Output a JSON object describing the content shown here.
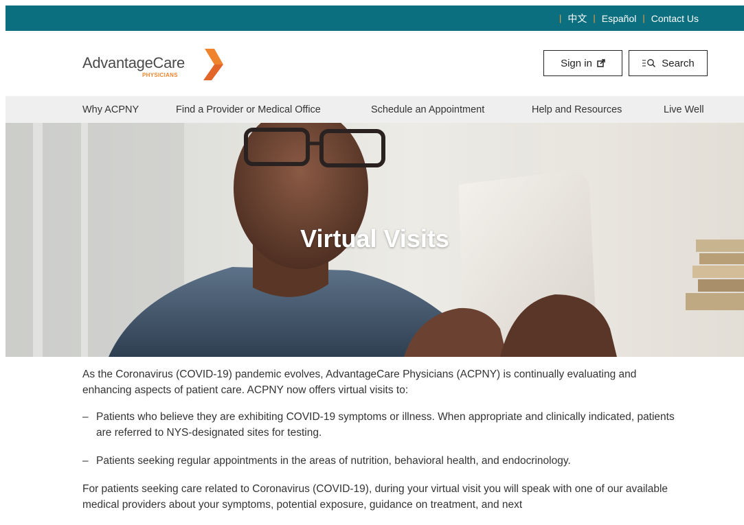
{
  "utility_nav": {
    "chinese": "中文",
    "spanish": "Español",
    "contact": "Contact Us"
  },
  "brand": {
    "name": "AdvantageCare",
    "sub": "PHYSICIANS"
  },
  "header": {
    "signin_label": "Sign in",
    "search_label": "Search"
  },
  "main_nav": [
    "Why ACPNY",
    "Find a Provider or Medical Office",
    "Schedule an Appointment",
    "Help and Resources",
    "Live Well"
  ],
  "hero": {
    "title": "Virtual Visits"
  },
  "content": {
    "intro": "As the Coronavirus (COVID-19) pandemic evolves, AdvantageCare Physicians (ACPNY) is continually evaluating and enhancing aspects of patient care. ACPNY now offers virtual visits to:",
    "bullets": [
      "Patients who believe they are exhibiting COVID-19 symptoms or illness. When appropriate and clinically indicated, patients are referred to NYS-designated sites for testing.",
      "Patients seeking regular appointments in the areas of nutrition, behavioral health, and endocrinology."
    ],
    "covid_paragraph": "For patients seeking care related to Coronavirus (COVID-19), during your virtual visit you will speak with one of our available medical providers about your symptoms, potential exposure, guidance on treatment, and next"
  },
  "colors": {
    "utility_bar": "#0b6f80",
    "accent_orange": "#f0842e",
    "nav_bg": "#efefef"
  },
  "icons": {
    "signin": "external-link-icon",
    "search": "search-icon",
    "logo": "chevron-logo-mark"
  }
}
